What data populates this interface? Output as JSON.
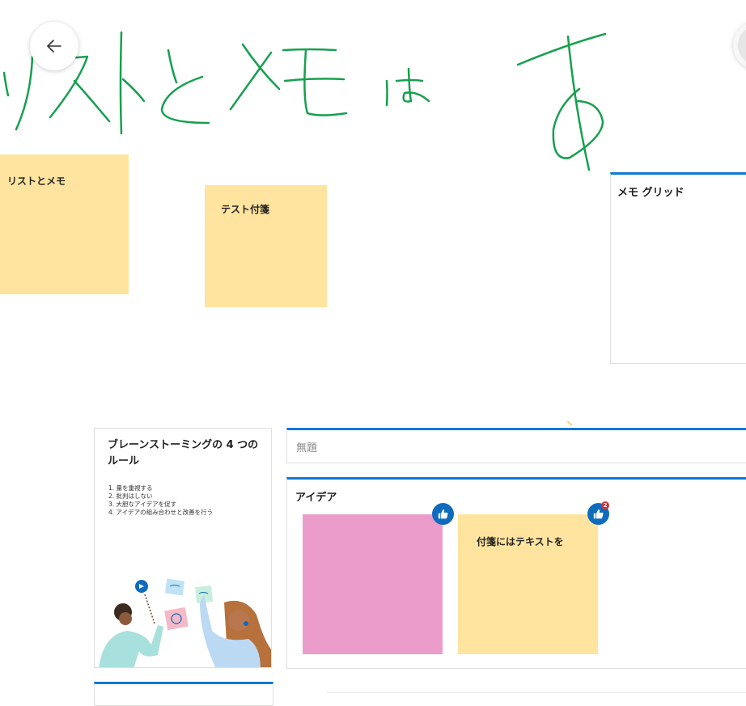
{
  "toolbar": {
    "back_icon": "arrow-left-icon"
  },
  "ink": {
    "handwriting": "リストとメモは　あ",
    "color": "#17a04f"
  },
  "notes": [
    {
      "text": "リストとメモ",
      "color": "#ffe4a0"
    },
    {
      "text": "テスト付箋",
      "color": "#ffe4a0"
    }
  ],
  "memo_grid": {
    "title": "メモ グリッド",
    "accent": "#0f78d4"
  },
  "brainstorm": {
    "title": "ブレーンストーミングの 4 つのルール",
    "rules": [
      "1. 量を重視する",
      "2. 批判はしない",
      "3. 大胆なアイデアを促す",
      "4. アイデアの組み合わせと改善を行う"
    ]
  },
  "untitled": {
    "text": "無題"
  },
  "ideas": {
    "title": "アイデア",
    "notes": [
      {
        "text": "",
        "color": "#ec9ccb",
        "like_icon": "thumbs-up-icon"
      },
      {
        "text": "付箋にはテキストを",
        "color": "#ffe4a0",
        "like_icon": "thumbs-up-icon",
        "like_count": "2"
      }
    ]
  }
}
